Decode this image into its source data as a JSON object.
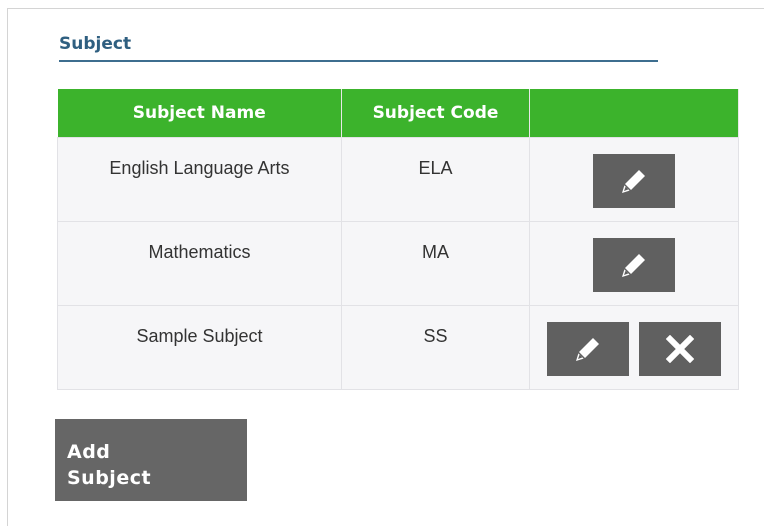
{
  "section": {
    "title": "Subject"
  },
  "table": {
    "headers": {
      "name": "Subject Name",
      "code": "Subject Code",
      "actions": ""
    },
    "rows": [
      {
        "name": "English Language Arts",
        "code": "ELA",
        "actions": [
          "edit"
        ]
      },
      {
        "name": "Mathematics",
        "code": "MA",
        "actions": [
          "edit"
        ]
      },
      {
        "name": "Sample Subject",
        "code": "SS",
        "actions": [
          "edit",
          "delete"
        ]
      }
    ]
  },
  "add_button": {
    "line1": "Add",
    "line2": "Subject"
  },
  "icons": {
    "edit": "pencil-icon",
    "delete": "close-icon"
  },
  "colors": {
    "header_bg": "#3cb32c",
    "title": "#2f5f80",
    "button_bg": "#606060",
    "row_bg": "#f6f6f8"
  }
}
